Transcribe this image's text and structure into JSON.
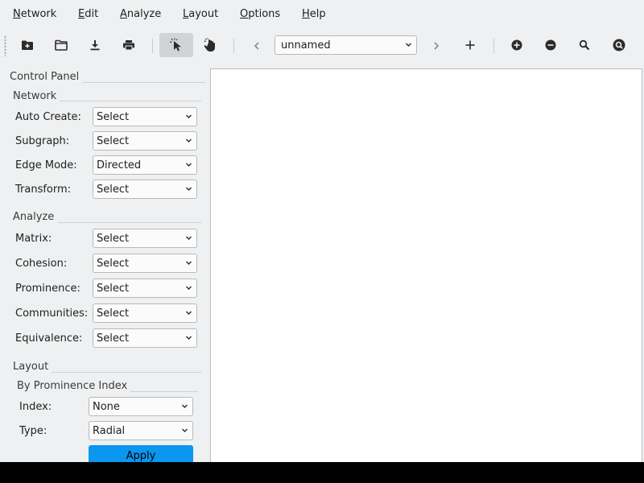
{
  "menubar": {
    "items": [
      {
        "mnemonic": "N",
        "rest": "etwork"
      },
      {
        "mnemonic": "E",
        "rest": "dit"
      },
      {
        "mnemonic": "A",
        "rest": "nalyze"
      },
      {
        "mnemonic": "L",
        "rest": "ayout"
      },
      {
        "mnemonic": "O",
        "rest": "ptions"
      },
      {
        "mnemonic": "H",
        "rest": "elp"
      }
    ]
  },
  "toolbar": {
    "icons": [
      "new-folder-icon",
      "open-folder-icon",
      "download-icon",
      "print-icon",
      "select-pointer-icon",
      "pan-hand-icon",
      "previous-icon",
      "next-icon",
      "add-icon",
      "zoom-in-icon",
      "zoom-out-icon",
      "zoom-fit-icon",
      "reset-view-icon"
    ],
    "network_selector": {
      "value": "unnamed"
    },
    "active_tool": "select-pointer"
  },
  "control_panel": {
    "title": "Control Panel",
    "network": {
      "title": "Network",
      "rows": [
        {
          "label": "Auto Create:",
          "value": "Select"
        },
        {
          "label": "Subgraph:",
          "value": "Select"
        },
        {
          "label": "Edge Mode:",
          "value": "Directed"
        },
        {
          "label": "Transform:",
          "value": "Select"
        }
      ]
    },
    "analyze": {
      "title": "Analyze",
      "rows": [
        {
          "label": "Matrix:",
          "value": "Select"
        },
        {
          "label": "Cohesion:",
          "value": "Select"
        },
        {
          "label": "Prominence:",
          "value": "Select"
        },
        {
          "label": "Communities:",
          "value": "Select"
        },
        {
          "label": "Equivalence:",
          "value": "Select"
        }
      ]
    },
    "layout": {
      "title": "Layout",
      "subtitle": "By Prominence Index",
      "rows": [
        {
          "label": "Index:",
          "value": "None"
        },
        {
          "label": "Type:",
          "value": "Radial"
        }
      ],
      "apply_label": "Apply"
    }
  },
  "colors": {
    "accent": "#0b96f0",
    "window_bg": "#eff0f1",
    "canvas_bg": "#ffffff"
  }
}
